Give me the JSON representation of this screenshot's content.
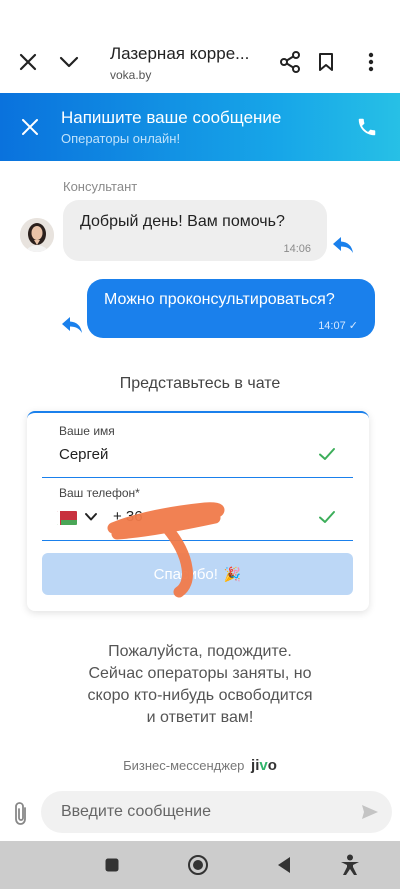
{
  "browser": {
    "page_title": "Лазерная корре...",
    "url": "voka.by",
    "icons": [
      "close-icon",
      "chevron-down-icon",
      "share-icon",
      "bookmark-icon",
      "more-vertical-icon"
    ]
  },
  "chat_header": {
    "title": "Напишите ваше сообщение",
    "subtitle": "Операторы онлайн!",
    "accent_color": "#1a80ec"
  },
  "messages": [
    {
      "sender_label": "Консультант",
      "text": "Добрый день! Вам помочь?",
      "time": "14:06",
      "direction": "incoming"
    },
    {
      "text": "Можно проконсультироваться?",
      "time": "14:07",
      "direction": "outgoing",
      "status": "✓"
    }
  ],
  "intro_form": {
    "title": "Представьтесь в чате",
    "name_label": "Ваше имя",
    "name_value": "Сергей",
    "phone_label": "Ваш телефон*",
    "phone_value": "+              36",
    "submit_label": "Спасибо!",
    "submit_emoji": "🎉"
  },
  "wait_message": {
    "line1": "Пожалуйста, подождите.",
    "line2": "Сейчас операторы заняты, но",
    "line3": "скоро кто-нибудь освободится",
    "line4": "и ответит вам!"
  },
  "powered_by": {
    "text": "Бизнес-мессенджер",
    "brand": "jivo"
  },
  "composer": {
    "placeholder": "Введите сообщение"
  }
}
